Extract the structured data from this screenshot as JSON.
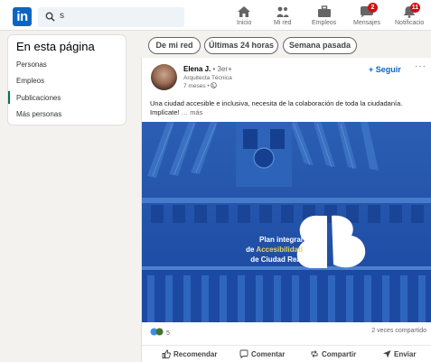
{
  "colors": {
    "brand": "#0a66c2",
    "badge": "#cc1016",
    "active_marker": "#01754f",
    "image_blue": "#1e50a8"
  },
  "nav": {
    "logo": "in",
    "search_value": "s",
    "items": [
      {
        "icon": "home-icon",
        "label": "Inicio",
        "badge": ""
      },
      {
        "icon": "my-network-icon",
        "label": "Mi red",
        "badge": ""
      },
      {
        "icon": "jobs-icon",
        "label": "Empleos",
        "badge": ""
      },
      {
        "icon": "messaging-icon",
        "label": "Mensajes",
        "badge": "2"
      },
      {
        "icon": "notifications-icon",
        "label": "Notificacio",
        "badge": "11"
      }
    ]
  },
  "sidebar": {
    "title": "En esta página",
    "items": [
      {
        "label": "Personas"
      },
      {
        "label": "Empleos"
      },
      {
        "label": "Publicaciones"
      },
      {
        "label": "Más personas"
      }
    ]
  },
  "filters": [
    {
      "label": "De mi red"
    },
    {
      "label": "Últimas 24 horas"
    },
    {
      "label": "Semana pasada"
    }
  ],
  "post": {
    "author": "Elena J.",
    "degree": "• 3er+",
    "headline": "Arquitecta Técnica",
    "time": "7 meses •",
    "follow_label": "+ Seguir",
    "more_label": "···",
    "text": "Una ciudad accesible e inclusiva, necesita de la colaboración de toda la ciudadanía. Implícate!",
    "see_more": "… más",
    "image_text": {
      "line1": "Plan integral",
      "line2_prefix": "de ",
      "line2_highlight": "Accesibilidad",
      "line3": "de Ciudad Real"
    },
    "reactions_count": "5",
    "shares": "2 veces compartido",
    "actions": [
      {
        "icon": "like-icon",
        "label": "Recomendar"
      },
      {
        "icon": "comment-icon",
        "label": "Comentar"
      },
      {
        "icon": "repost-icon",
        "label": "Compartir"
      },
      {
        "icon": "send-icon",
        "label": "Enviar"
      }
    ]
  }
}
